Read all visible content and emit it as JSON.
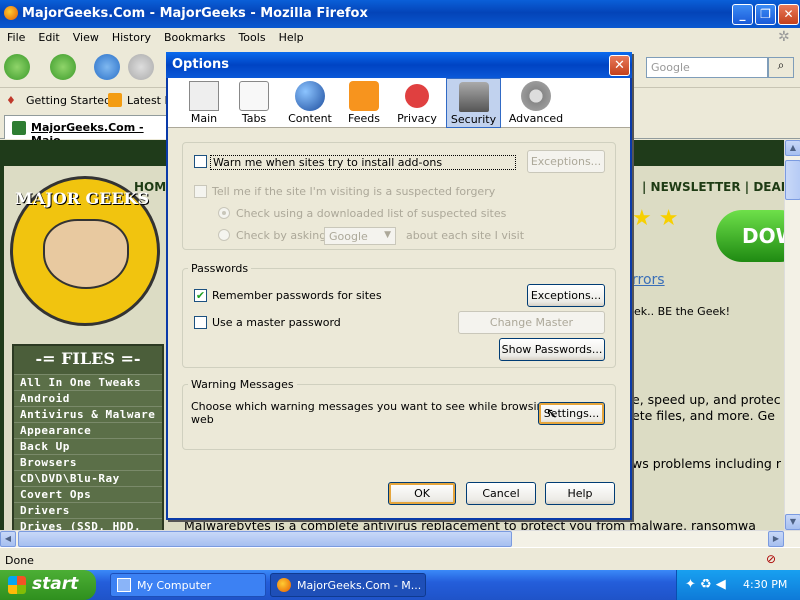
{
  "browser": {
    "title": "MajorGeeks.Com - MajorGeeks - Mozilla Firefox",
    "menu": [
      "File",
      "Edit",
      "View",
      "History",
      "Bookmarks",
      "Tools",
      "Help"
    ],
    "search_placeholder": "Google",
    "bookmarks": [
      "Getting Started",
      "Latest H"
    ],
    "tab_title": "MajorGeeks.Com - Majo",
    "status": "Done"
  },
  "page": {
    "home_label": "HOM",
    "nav_right": "| NEWSLETTER | DEALS",
    "download_label": "DOW",
    "mirrors": "rrors",
    "geek_text": "ek.. BE the Geek!",
    "text_line1": "e, speed up, and protec",
    "text_line2": "ete files, and more. Ge",
    "text_line3": "ws problems including r",
    "malwarebytes": "Malwarebytes is a complete antivirus replacement to protect you from malware, ransomwa",
    "logo_text": "MAJOR GEEKS",
    "files_header": "-= FILES =-",
    "files": [
      "All In One Tweaks",
      "Android",
      "Antivirus & Malware",
      "Appearance",
      "Back Up",
      "Browsers",
      "CD\\DVD\\Blu-Ray",
      "Covert Ops",
      "Drivers",
      "Drives (SSD, HDD,"
    ]
  },
  "dialog": {
    "title": "Options",
    "tabs": [
      "Main",
      "Tabs",
      "Content",
      "Feeds",
      "Privacy",
      "Security",
      "Advanced"
    ],
    "selected_tab": "Security",
    "addons": {
      "warn_label": "Warn me when sites try to install add-ons",
      "warn_checked": false,
      "exceptions_label": "Exceptions...",
      "forgery_label": "Tell me if the site I'm visiting is a suspected forgery",
      "radio1": "Check using a downloaded list of suspected sites",
      "radio2_prefix": "Check by asking",
      "radio2_select": "Google",
      "radio2_suffix": "about each site I visit"
    },
    "passwords": {
      "group_label": "Passwords",
      "remember_label": "Remember passwords for sites",
      "remember_checked": true,
      "exceptions_label": "Exceptions...",
      "master_label": "Use a master password",
      "master_checked": false,
      "change_master_label": "Change Master Password...",
      "show_passwords_label": "Show Passwords..."
    },
    "warnings": {
      "group_label": "Warning Messages",
      "description_line1": "Choose which warning messages you want to see while browsing the",
      "description_line2": "web",
      "settings_label": "Settings..."
    },
    "ok_label": "OK",
    "cancel_label": "Cancel",
    "help_label": "Help"
  },
  "taskbar": {
    "start_label": "start",
    "tasks": [
      "My Computer",
      "MajorGeeks.Com - M..."
    ],
    "clock": "4:30 PM"
  }
}
